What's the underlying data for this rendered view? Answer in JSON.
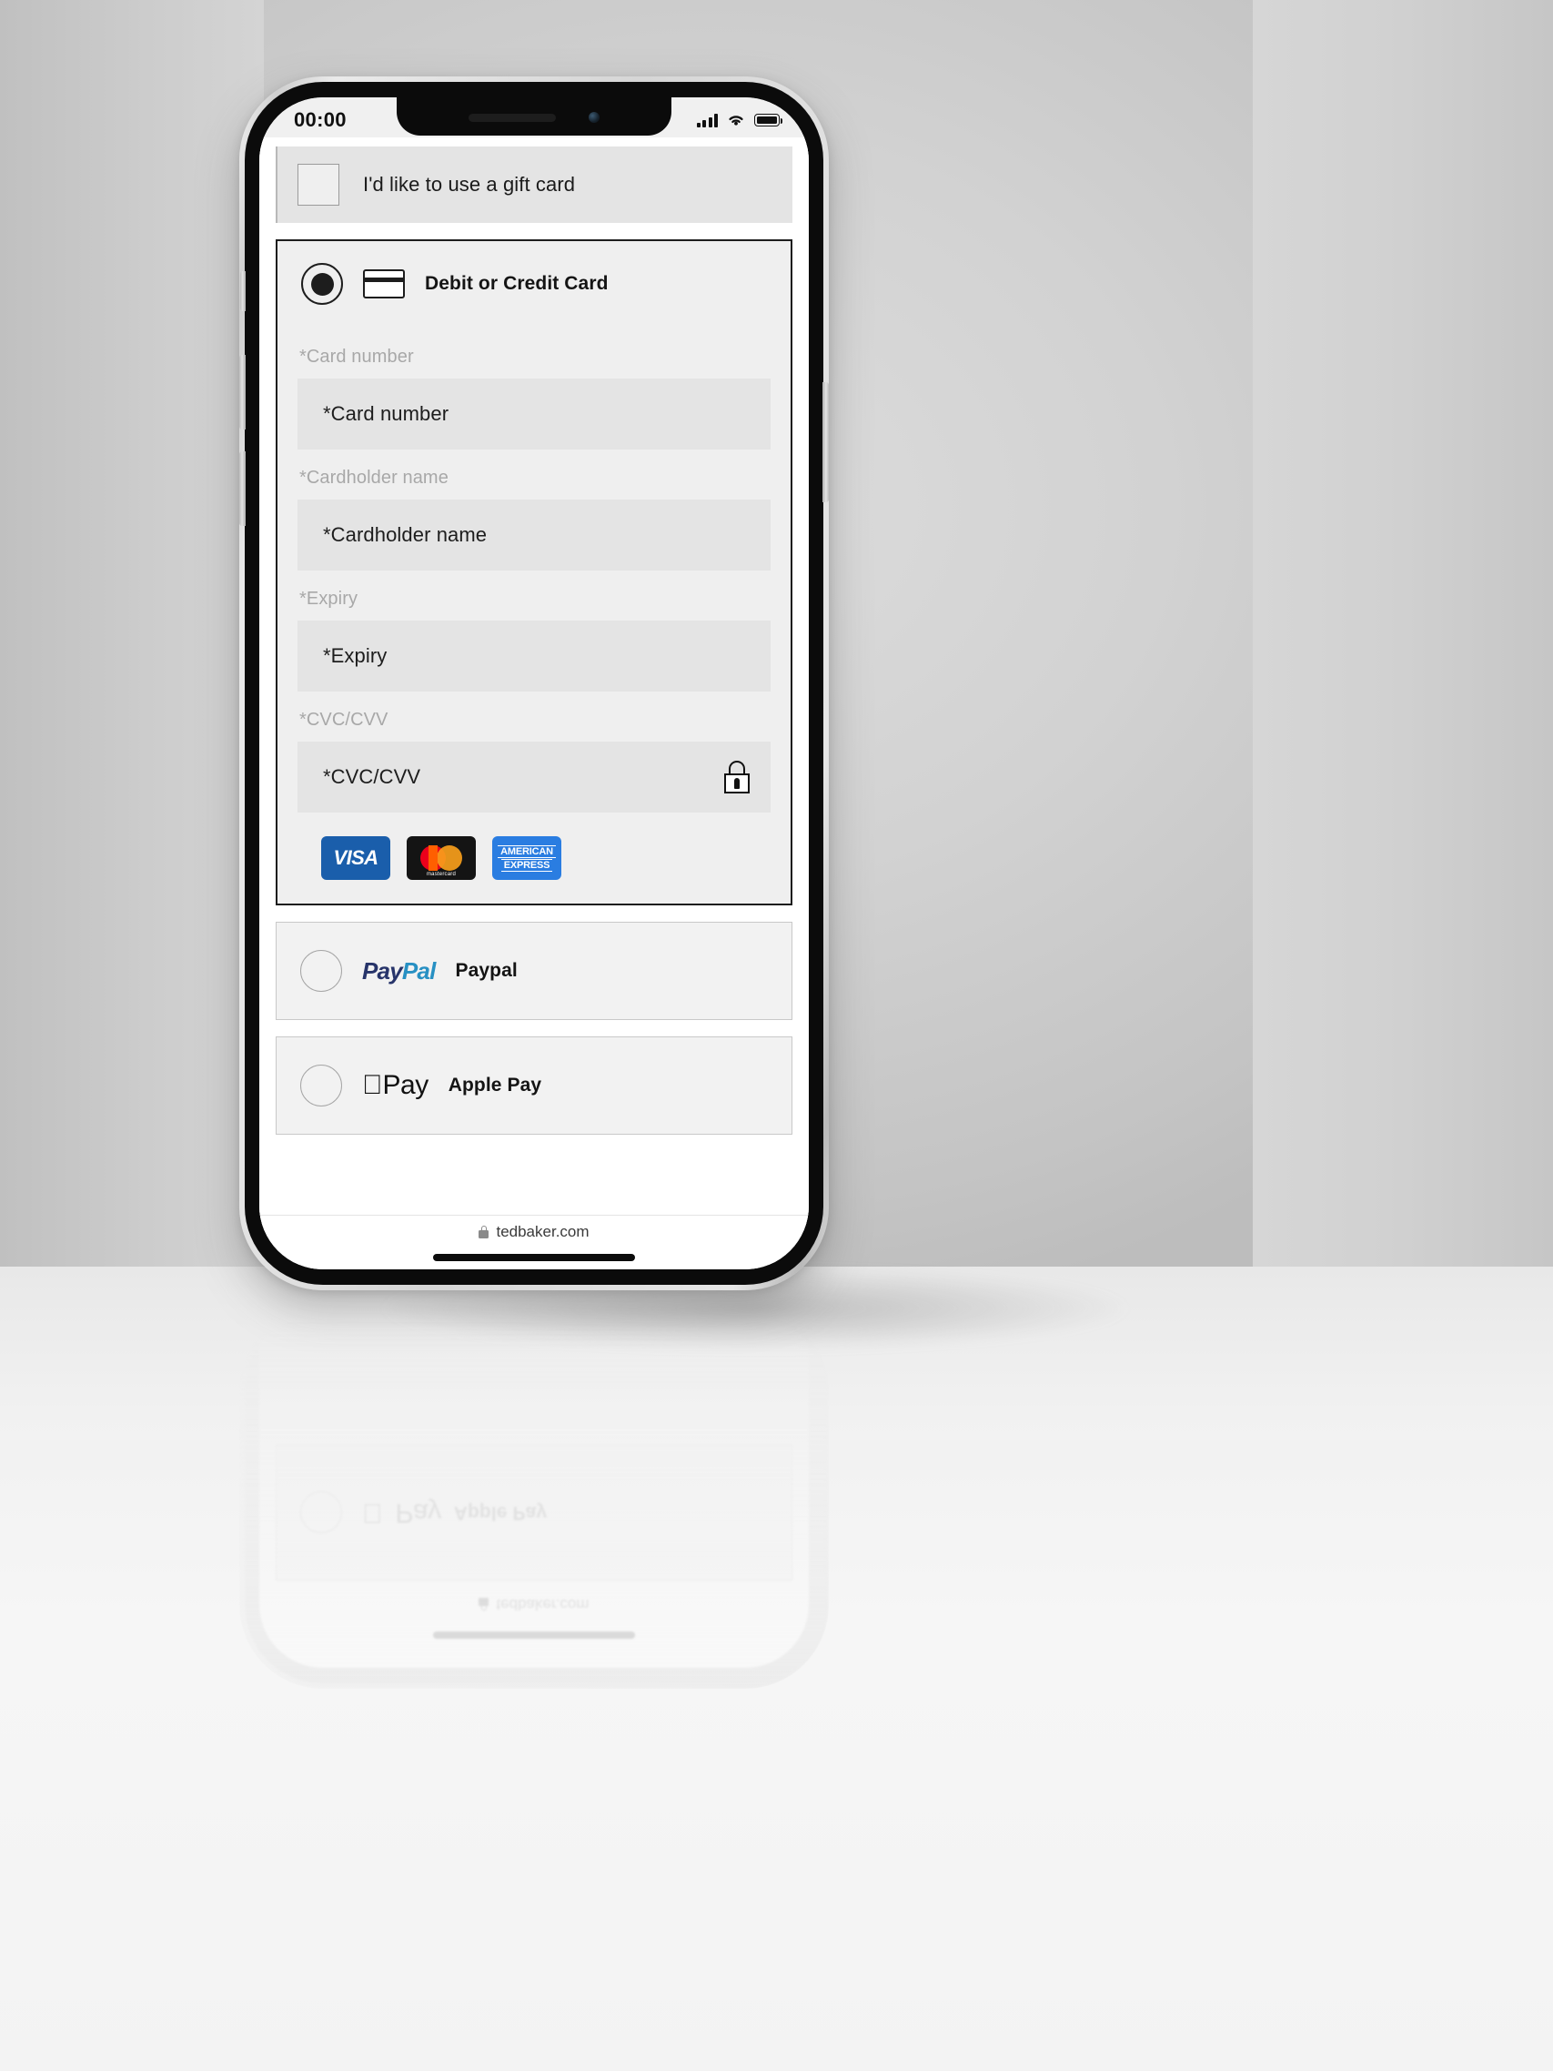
{
  "status_bar": {
    "time": "00:00",
    "signal_icon": "cellular-signal-icon",
    "wifi_icon": "wifi-icon",
    "battery_icon": "battery-icon"
  },
  "gift_card": {
    "label": "I'd like to use a gift card",
    "checked": false
  },
  "payment_methods": [
    {
      "id": "card",
      "label": "Debit or Credit Card",
      "selected": true,
      "icon": "credit-card-icon"
    },
    {
      "id": "paypal",
      "label": "Paypal",
      "selected": false,
      "logo_part1": "Pay",
      "logo_part2": "Pal"
    },
    {
      "id": "applepay",
      "label": "Apple Pay",
      "selected": false,
      "logo_mark": "",
      "logo_word": "Pay"
    }
  ],
  "card_form": {
    "fields": [
      {
        "label": "*Card number",
        "placeholder": "*Card number",
        "value": "",
        "trailing_icon": ""
      },
      {
        "label": "*Cardholder name",
        "placeholder": "*Cardholder name",
        "value": "",
        "trailing_icon": ""
      },
      {
        "label": "*Expiry",
        "placeholder": "*Expiry",
        "value": "",
        "trailing_icon": ""
      },
      {
        "label": "*CVC/CVV",
        "placeholder": "*CVC/CVV",
        "value": "",
        "trailing_icon": "lock-icon"
      }
    ]
  },
  "accepted_cards": [
    {
      "name": "visa",
      "text": "VISA",
      "color": "#1a5eab"
    },
    {
      "name": "mastercard",
      "text": "mastercard",
      "color": "#141414"
    },
    {
      "name": "american-express",
      "line1": "AMERICAN",
      "line2": "EXPRESS",
      "color": "#2a7de1"
    }
  ],
  "browser": {
    "url": "tedbaker.com",
    "lock_icon": "padlock-icon"
  },
  "reflection": {
    "url": "tedbaker.com",
    "apple_pay_label": "Apple Pay"
  }
}
